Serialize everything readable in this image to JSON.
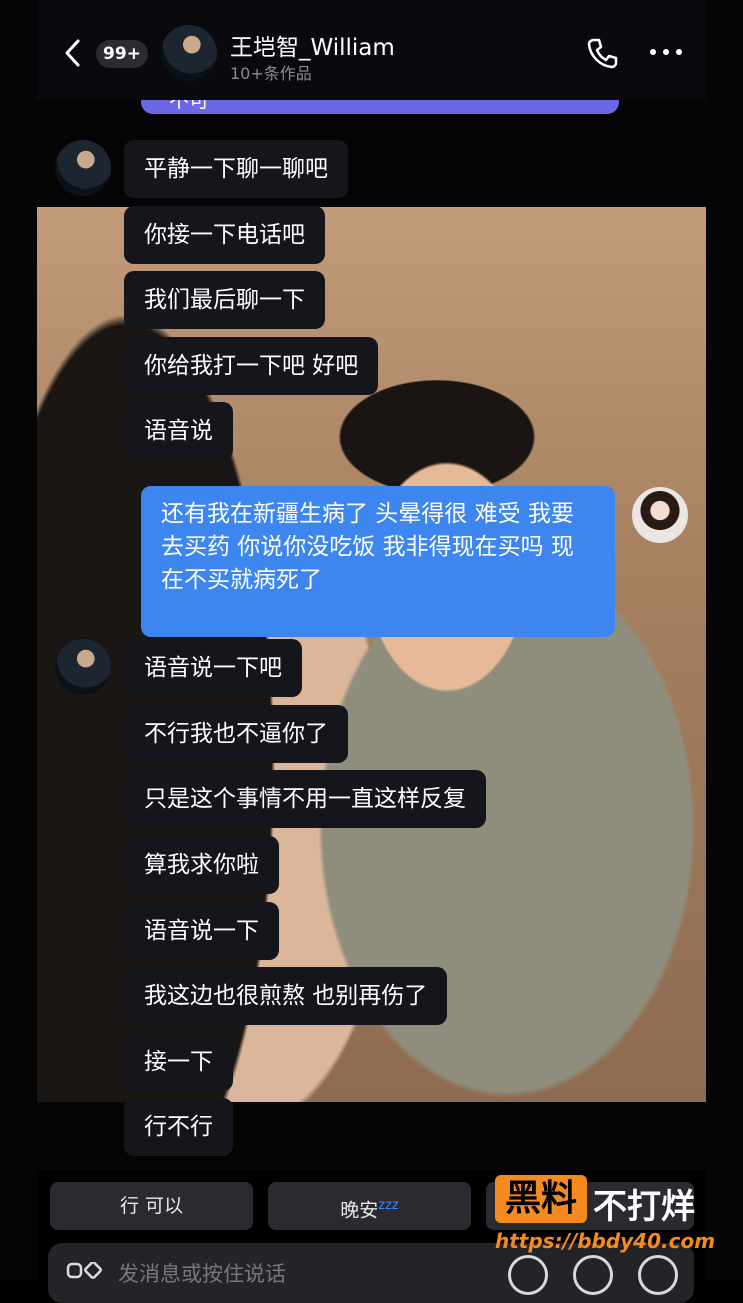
{
  "header": {
    "unread_badge": "99+",
    "contact_name": "王垲智_William",
    "subtitle": "10+条作品"
  },
  "chat": {
    "top_partial_text": "不可",
    "incoming_group_1": [
      "平静一下聊一聊吧",
      "你接一下电话吧",
      "我们最后聊一下",
      "你给我打一下吧 好吧",
      "语音说"
    ],
    "outgoing_message": "还有我在新疆生病了 头晕得很 难受 我要去买药 你说你没吃饭 我非得现在买吗 现在不买就病死了",
    "incoming_group_2": [
      "语音说一下吧",
      "不行我也不逼你了",
      "只是这个事情不用一直这样反复",
      "算我求你啦",
      "语音说一下",
      "我这边也很煎熬 也别再伤了",
      "接一下",
      "行不行"
    ]
  },
  "quick_replies": {
    "reply_1": "行 可以",
    "reply_2": "晚安",
    "reply_2_icon": "zzz"
  },
  "input": {
    "placeholder": "发消息或按住说话"
  },
  "watermark": {
    "box_text": "黑料",
    "text": "不打烊",
    "url": "https://bbdy40.com"
  },
  "colors": {
    "outgoing_bubble": "#3d86f0",
    "incoming_bubble": "#15161b",
    "pk_stripe": "#6c67e8",
    "watermark_orange": "#f58a1f"
  }
}
